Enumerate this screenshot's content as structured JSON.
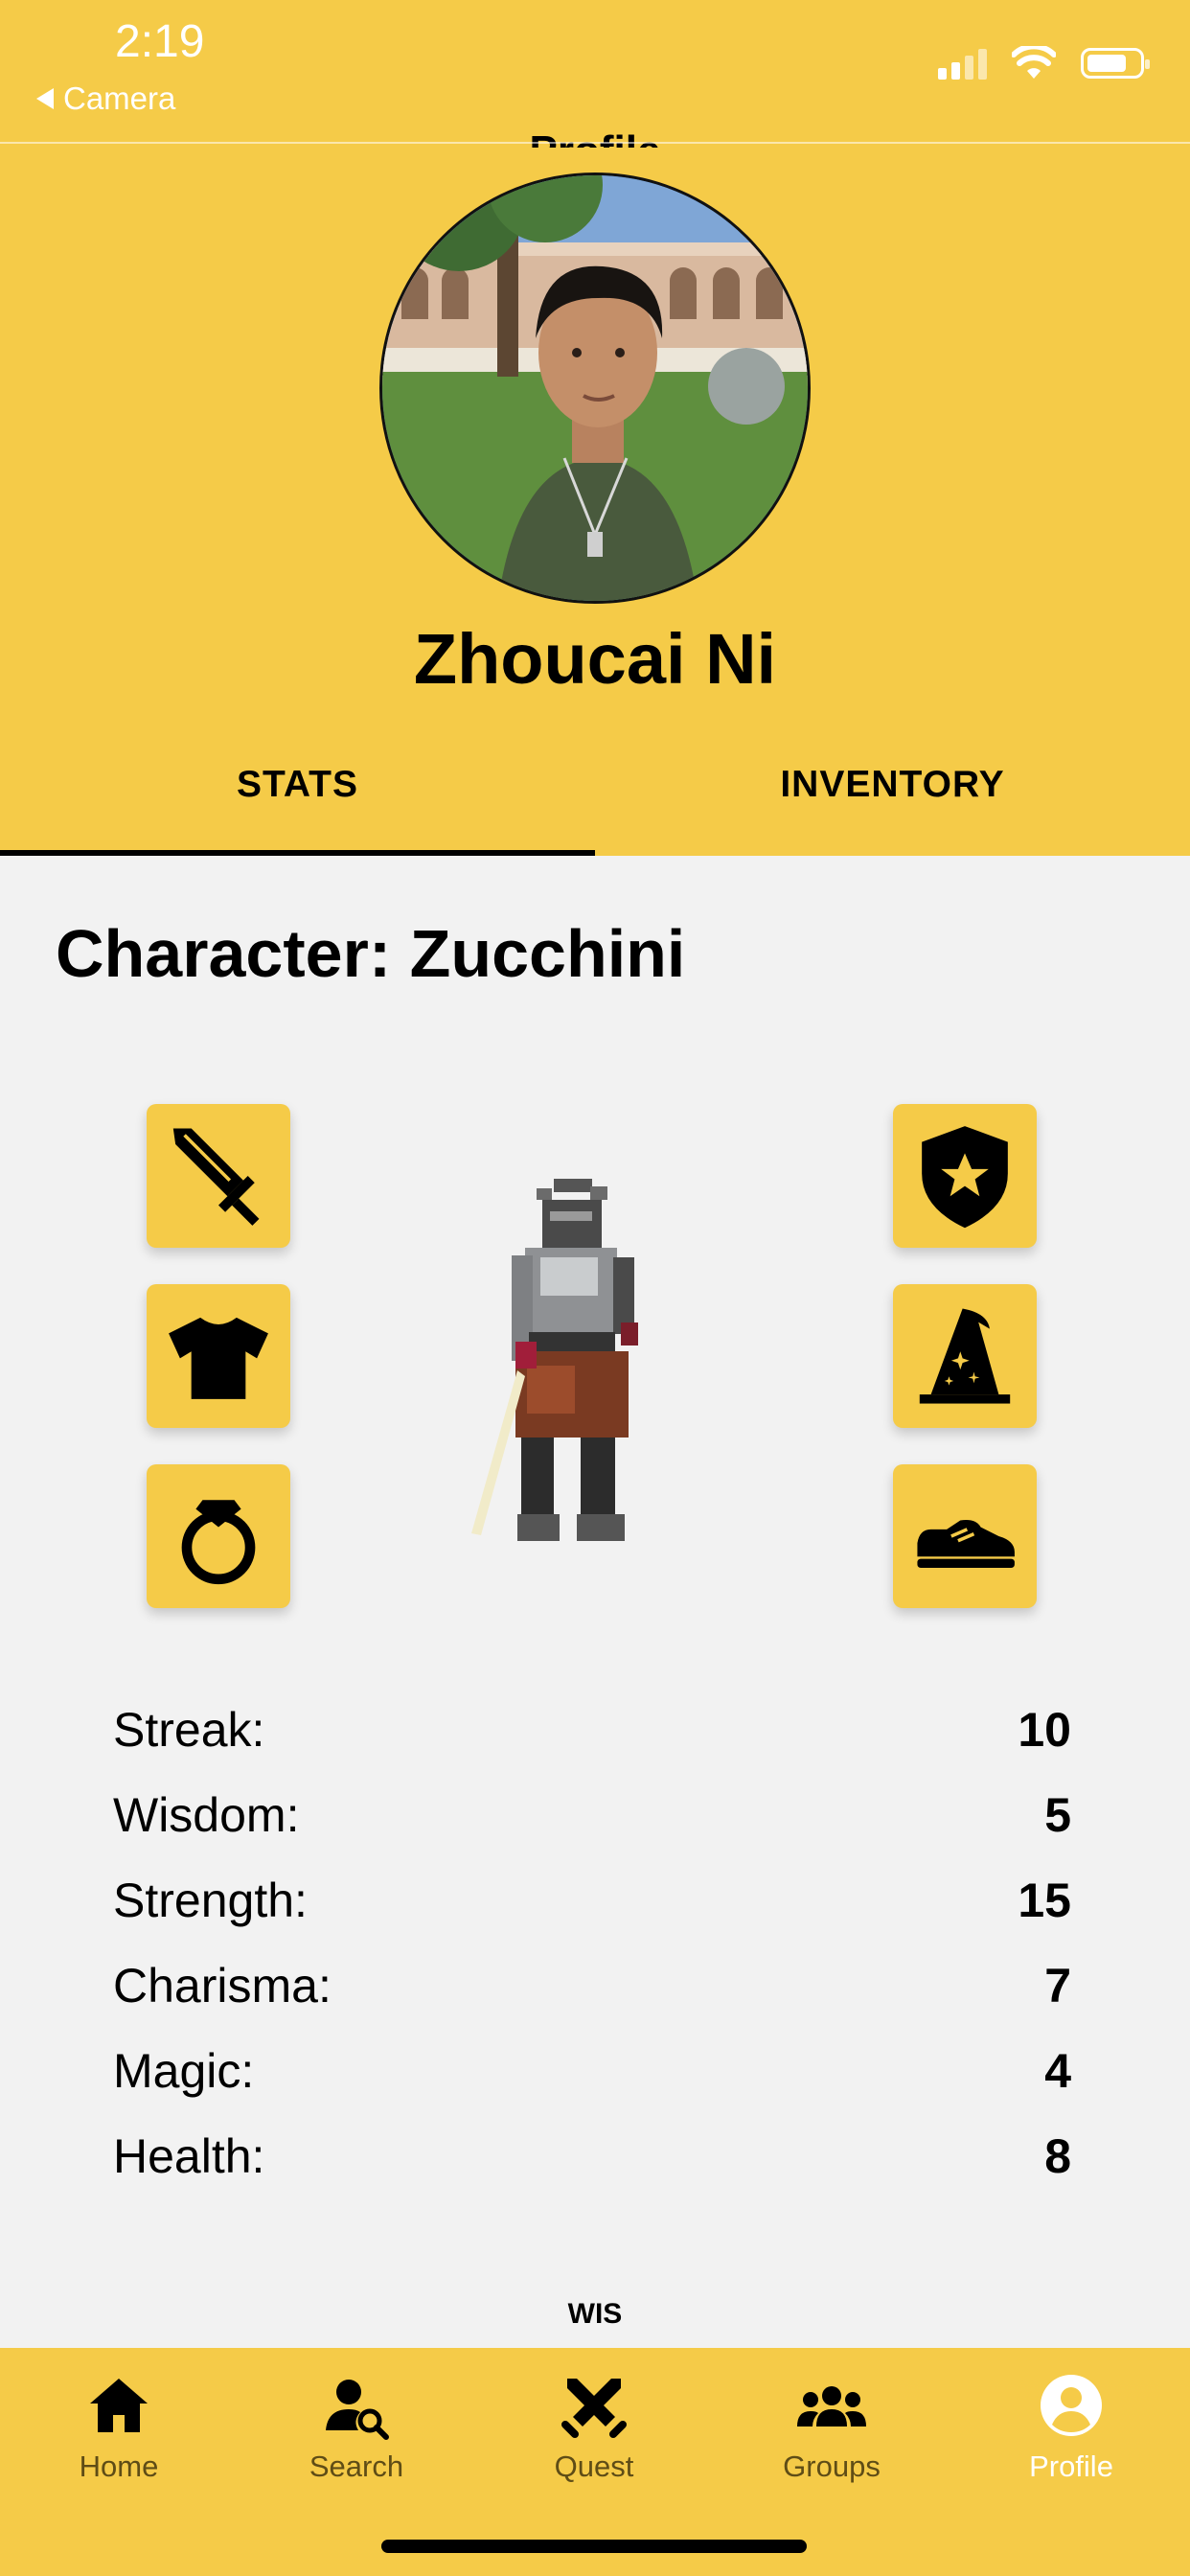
{
  "status_bar": {
    "time": "2:19",
    "back_label": "Camera"
  },
  "nav": {
    "title": "Profile"
  },
  "profile": {
    "name": "Zhoucai Ni"
  },
  "tabs": [
    {
      "label": "STATS",
      "active": true
    },
    {
      "label": "INVENTORY",
      "active": false
    }
  ],
  "character": {
    "title": "Character: Zucchini"
  },
  "equipment": {
    "left": [
      "sword-icon",
      "shirt-icon",
      "ring-icon"
    ],
    "right": [
      "shield-star-icon",
      "wizard-hat-icon",
      "sneaker-icon"
    ]
  },
  "stats": [
    {
      "label": "Streak:",
      "value": "10"
    },
    {
      "label": "Wisdom:",
      "value": "5"
    },
    {
      "label": "Strength:",
      "value": "15"
    },
    {
      "label": "Charisma:",
      "value": "7"
    },
    {
      "label": "Magic:",
      "value": "4"
    },
    {
      "label": "Health:",
      "value": "8"
    }
  ],
  "wis_label": "WIS",
  "bottom_nav": [
    {
      "label": "Home",
      "icon": "home-icon",
      "active": false
    },
    {
      "label": "Search",
      "icon": "user-search-icon",
      "active": false
    },
    {
      "label": "Quest",
      "icon": "crossed-swords-icon",
      "active": false
    },
    {
      "label": "Groups",
      "icon": "group-icon",
      "active": false
    },
    {
      "label": "Profile",
      "icon": "profile-icon",
      "active": true
    }
  ],
  "colors": {
    "accent": "#f5cb48",
    "background": "#f2f2f2",
    "inactive_label": "#5f4d16",
    "active_label": "#ffffff"
  }
}
